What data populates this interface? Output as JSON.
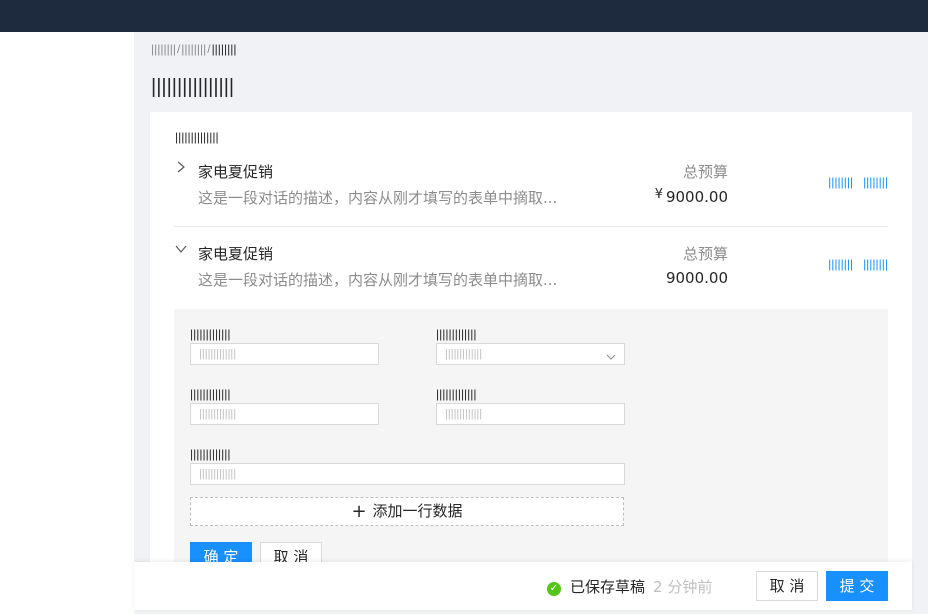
{
  "breadcrumb": {
    "items": [
      "||||||||",
      "||||||||"
    ],
    "current": "||||||||"
  },
  "page": {
    "title": "||||||||||||||||"
  },
  "card": {
    "title": "||||||||||||||",
    "rows": [
      {
        "name": "家电夏促销",
        "description": "这是一段对话的描述，内容从刚才填写的表单中摘取...",
        "budget_label": "总预算",
        "currency": "¥",
        "budget_value": "9000.00",
        "actions": [
          "||||||||",
          "||||||||"
        ],
        "expanded": false
      },
      {
        "name": "家电夏促销",
        "description": "这是一段对话的描述，内容从刚才填写的表单中摘取...",
        "budget_label": "总预算",
        "budget_value": "9000.00",
        "actions": [
          "||||||||",
          "||||||||"
        ],
        "expanded": true
      }
    ]
  },
  "form": {
    "fields": [
      {
        "label": "|||||||||||||",
        "placeholder": "|||||||||||||"
      },
      {
        "label": "|||||||||||||",
        "placeholder": "|||||||||||||",
        "type": "select"
      },
      {
        "label": "|||||||||||||",
        "placeholder": "|||||||||||||"
      },
      {
        "label": "|||||||||||||",
        "placeholder": "|||||||||||||"
      },
      {
        "label": "|||||||||||||",
        "placeholder": "|||||||||||||"
      }
    ],
    "add_row_label": "添加一行数据",
    "confirm_label": "确 定",
    "cancel_label": "取 消"
  },
  "footer": {
    "status_text": "已保存草稿",
    "status_time": "2 分钟前",
    "cancel_label": "取 消",
    "submit_label": "提 交"
  },
  "colors": {
    "topbar": "#1e2a3e",
    "primary": "#1890ff",
    "success": "#52c41a",
    "expand_bg": "#f5f5f5"
  },
  "icons": [
    "chevron-right-icon",
    "chevron-down-icon",
    "chevron-down-icon",
    "plus-icon",
    "check-circle-icon"
  ]
}
